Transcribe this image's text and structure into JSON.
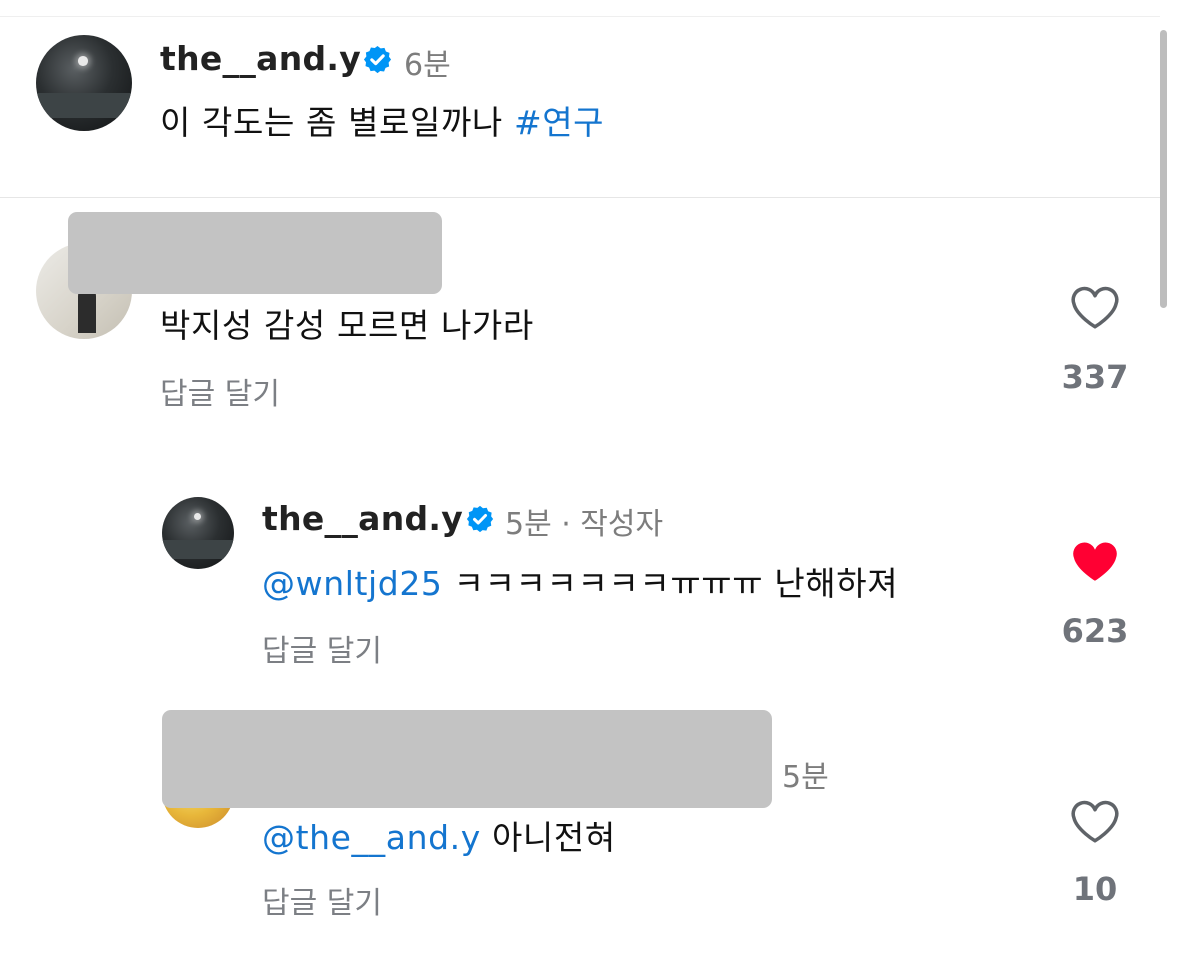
{
  "post": {
    "username": "the__and.y",
    "time": "6분",
    "text": "이 각도는 좀 별로일까나",
    "hashtag": "#연구"
  },
  "comments": [
    {
      "text": "박지성 감성 모르면 나가라",
      "reply_label": "답글 달기",
      "like_count": "337",
      "liked": false
    },
    {
      "username": "the__and.y",
      "time": "5분",
      "author_tag": "· 작성자",
      "mention": "@wnltjd25",
      "text": "ㅋㅋㅋㅋㅋㅋㅋㅠㅠㅠ 난해하져",
      "reply_label": "답글 달기",
      "like_count": "623",
      "liked": true
    },
    {
      "time": "5분",
      "mention": "@the__and.y",
      "text": "아니전혀",
      "reply_label": "답글 달기",
      "like_count": "10",
      "liked": false
    }
  ],
  "colors": {
    "mention": "#1475cf",
    "verified": "#0095f6",
    "liked_heart": "#ff0033",
    "redaction": "#c3c3c3"
  },
  "icons": {
    "verified": "verified-badge-icon",
    "like": "heart-outline-icon",
    "liked": "heart-filled-icon"
  }
}
